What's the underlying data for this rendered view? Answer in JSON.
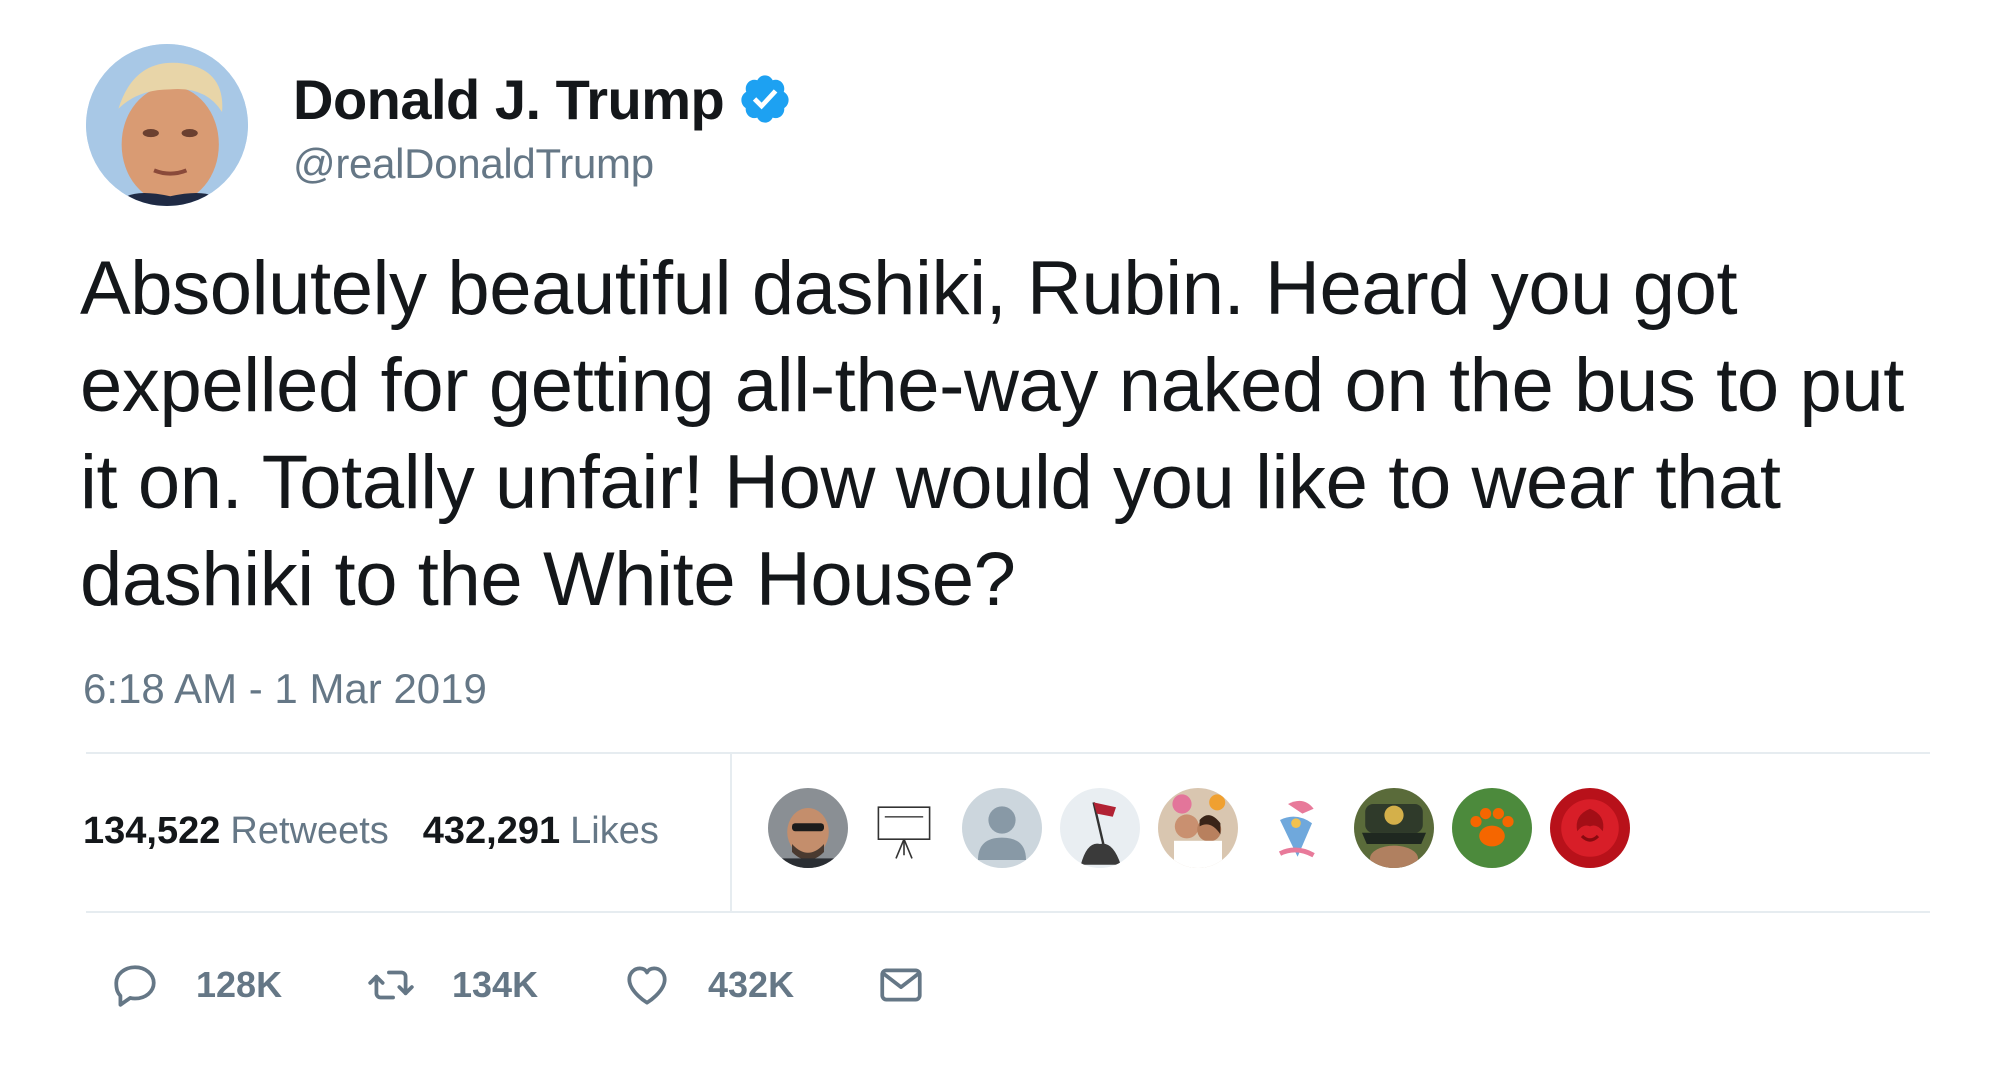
{
  "author": {
    "display_name": "Donald J. Trump",
    "handle": "@realDonaldTrump",
    "verified_icon": "verified-badge-icon",
    "avatar_icon": "profile-photo"
  },
  "tweet": {
    "text": "Absolutely beautiful dashiki, Rubin. Heard you got expelled for getting all-the-way naked on the bus to put it on. Totally unfair! How would you like to wear that dashiki to the White House?",
    "timestamp": "6:18 AM - 1 Mar 2019"
  },
  "stats": {
    "retweets_count": "134,522",
    "retweets_label": "Retweets",
    "likes_count": "432,291",
    "likes_label": "Likes"
  },
  "actions": {
    "reply_count": "128K",
    "retweet_count": "134K",
    "like_count": "432K"
  },
  "colors": {
    "text_primary": "#14171a",
    "text_secondary": "#657786",
    "verified_blue": "#1da1f2",
    "divider": "#e6ecf0"
  }
}
